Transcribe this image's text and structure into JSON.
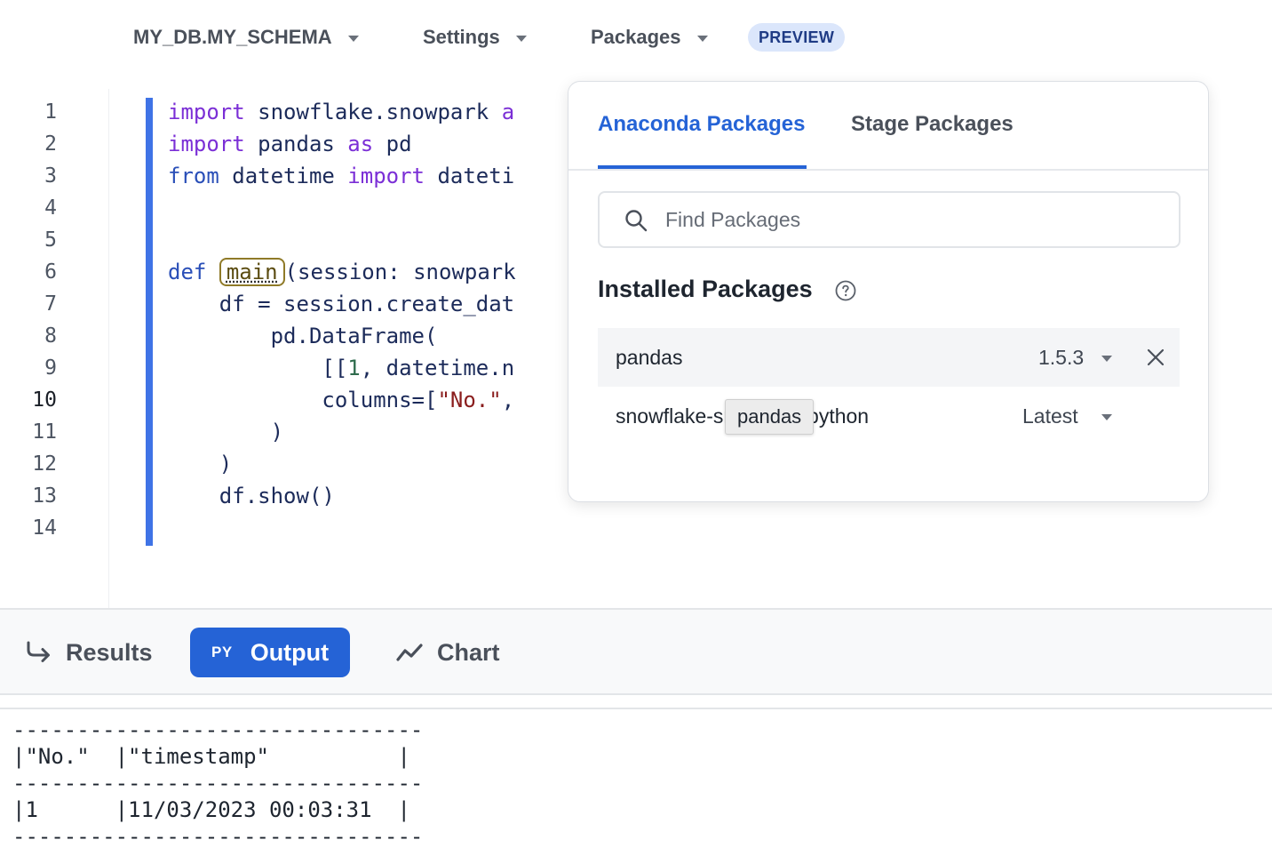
{
  "toolbar": {
    "context": "MY_DB.MY_SCHEMA",
    "settings": "Settings",
    "packages": "Packages",
    "badge": "PREVIEW"
  },
  "editor": {
    "line_numbers": [
      "1",
      "2",
      "3",
      "4",
      "5",
      "6",
      "7",
      "8",
      "9",
      "10",
      "11",
      "12",
      "13",
      "14"
    ],
    "active_line": "10",
    "lines": [
      [
        {
          "t": "import",
          "c": "kw"
        },
        {
          "t": " snowflake.snowpark "
        },
        {
          "t": "a",
          "c": "kw"
        }
      ],
      [
        {
          "t": "import",
          "c": "kw"
        },
        {
          "t": " pandas "
        },
        {
          "t": "as",
          "c": "kw"
        },
        {
          "t": " pd"
        }
      ],
      [
        {
          "t": "from",
          "c": "kw2"
        },
        {
          "t": " datetime "
        },
        {
          "t": "import",
          "c": "kw"
        },
        {
          "t": " dateti"
        }
      ],
      [],
      [],
      [
        {
          "t": "def",
          "c": "kw2"
        },
        {
          "t": " "
        },
        {
          "t": "main",
          "c": "fn-hl"
        },
        {
          "t": "(session: snowpark"
        }
      ],
      [
        {
          "t": "    df = session.create_dat"
        }
      ],
      [
        {
          "t": "        pd.DataFrame("
        }
      ],
      [
        {
          "t": "            [["
        },
        {
          "t": "1",
          "c": "num"
        },
        {
          "t": ", datetime.n"
        }
      ],
      [
        {
          "t": "            columns=["
        },
        {
          "t": "\"No.\"",
          "c": "str"
        },
        {
          "t": ","
        }
      ],
      [
        {
          "t": "        )"
        }
      ],
      [
        {
          "t": "    )"
        }
      ],
      [
        {
          "t": "    df.show()"
        }
      ],
      []
    ]
  },
  "packages_popup": {
    "tabs": [
      {
        "label": "Anaconda Packages",
        "active": true
      },
      {
        "label": "Stage Packages",
        "active": false
      }
    ],
    "search_placeholder": "Find Packages",
    "installed_title": "Installed Packages",
    "installed": [
      {
        "name": "pandas",
        "version": "1.5.3",
        "removable": true
      },
      {
        "name": "snowflake-snowpark-python",
        "version": "Latest",
        "removable": false
      }
    ],
    "tooltip": "pandas"
  },
  "results_tabs": [
    {
      "label": "Results",
      "icon": "return-arrow-icon",
      "active": false
    },
    {
      "label": "Output",
      "tag": "PY",
      "active": true
    },
    {
      "label": "Chart",
      "icon": "line-chart-icon",
      "active": false
    }
  ],
  "output": {
    "lines": [
      "--------------------------------",
      "|\"No.\"  |\"timestamp\"          |",
      "--------------------------------",
      "|1      |11/03/2023 00:03:31  |",
      "--------------------------------"
    ]
  },
  "colors": {
    "accent": "#2563d6",
    "change_bar": "#3f73e6",
    "badge_bg": "#dbe6fb"
  }
}
